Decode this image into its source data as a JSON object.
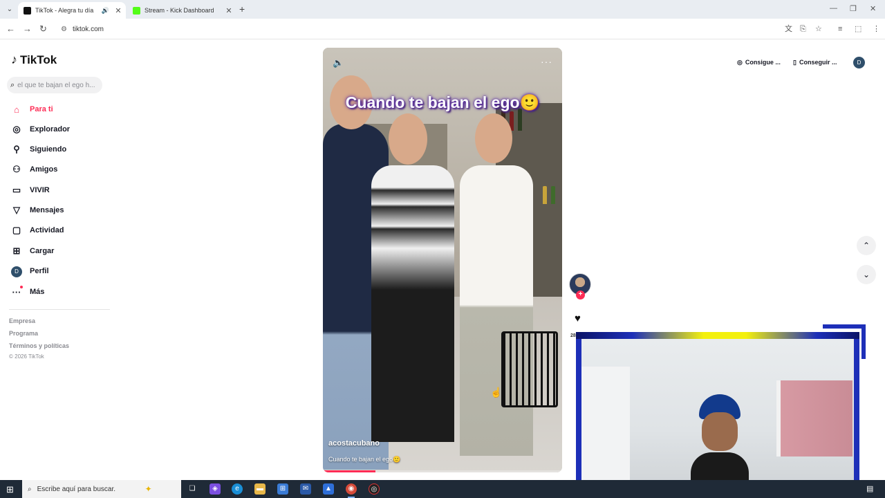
{
  "browser": {
    "tabs": [
      {
        "title": "TikTok - Alegra tu día",
        "active": true,
        "audio": true
      },
      {
        "title": "Stream - Kick Dashboard",
        "active": false,
        "audio": false
      }
    ],
    "url": "tiktok.com",
    "new_tab_icon": "plus-icon"
  },
  "tiktok": {
    "logo_text": "TikTok",
    "search_placeholder": "el que te bajan el ego h...",
    "nav": [
      {
        "label": "Para ti",
        "icon": "home-icon",
        "active": true
      },
      {
        "label": "Explorador",
        "icon": "compass-icon",
        "active": false
      },
      {
        "label": "Siguiendo",
        "icon": "person-check-icon",
        "active": false
      },
      {
        "label": "Amigos",
        "icon": "friends-icon",
        "active": false
      },
      {
        "label": "VIVIR",
        "icon": "live-tv-icon",
        "active": false
      },
      {
        "label": "Mensajes",
        "icon": "send-icon",
        "active": false
      },
      {
        "label": "Actividad",
        "icon": "chat-bubble-icon",
        "active": false
      },
      {
        "label": "Cargar",
        "icon": "plus-square-icon",
        "active": false
      },
      {
        "label": "Perfil",
        "icon": "avatar-icon",
        "active": false,
        "avatar_letter": "D"
      },
      {
        "label": "Más",
        "icon": "more-dots-icon",
        "active": false
      }
    ],
    "footer": {
      "links": [
        "Empresa",
        "Programa",
        "Términos y políticas"
      ],
      "copyright": "© 2026 TikTok"
    },
    "top_buttons": {
      "coins": "Consigue ...",
      "app": "Conseguir ...",
      "user_letter": "D"
    },
    "video": {
      "overlay_title": "Cuando te bajan el ego🙂",
      "author": "acostacubano",
      "caption": "Cuando te bajan el ego🙂",
      "progress": 0.22
    },
    "actions": {
      "like_count": "28"
    }
  },
  "taskbar": {
    "search_placeholder": "Escribe aquí para buscar."
  },
  "colors": {
    "accent": "#fe2c55",
    "webcam_frame": "#1d2fb8",
    "webcam_highlight": "#f3f00e"
  }
}
